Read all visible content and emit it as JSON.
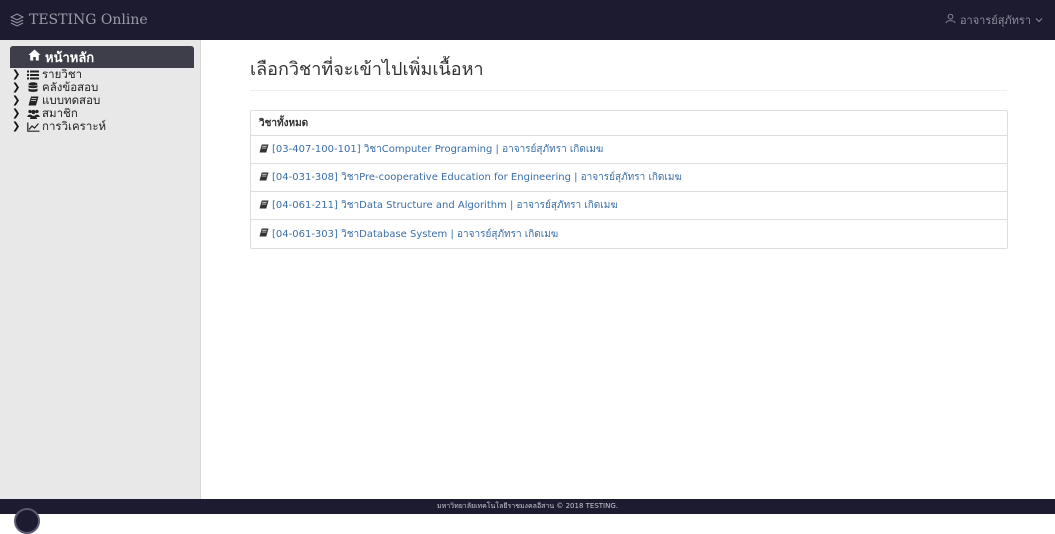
{
  "navbar": {
    "brand": "TESTING Online",
    "user": "อาจารย์สุภัทรา"
  },
  "sidebar": {
    "home": "หน้าหลัก",
    "items": [
      {
        "label": "รายวิชา",
        "icon": "list-icon"
      },
      {
        "label": "คลังข้อสอบ",
        "icon": "database-icon"
      },
      {
        "label": "แบบทดสอบ",
        "icon": "book-icon"
      },
      {
        "label": "สมาชิก",
        "icon": "users-icon"
      },
      {
        "label": "การวิเคราะห์",
        "icon": "line-chart-icon"
      }
    ]
  },
  "main": {
    "title": "เลือกวิชาที่จะเข้าไปเพิ่มเนื้อหา",
    "panel_heading": "วิชาทั้งหมด",
    "courses": [
      "[03-407-100-101] วิชาComputer Programing | อาจารย์สุภัทรา เกิดเมฆ",
      "[04-031-308] วิชาPre-cooperative Education for Engineering | อาจารย์สุภัทรา เกิดเมฆ",
      "[04-061-211] วิชาData Structure and Algorithm | อาจารย์สุภัทรา เกิดเมฆ",
      "[04-061-303] วิชาDatabase System | อาจารย์สุภัทรา เกิดเมฆ"
    ]
  },
  "footer": {
    "text": "มหาวิทยาลัยเทคโนโลยีราชมงคลอีสาน © 2018 TESTING."
  },
  "colors": {
    "navbar": "#1c1b2f",
    "sidebar": "#e8e8e8",
    "home_item": "#3e3e4a",
    "link": "#3a6ea5"
  }
}
